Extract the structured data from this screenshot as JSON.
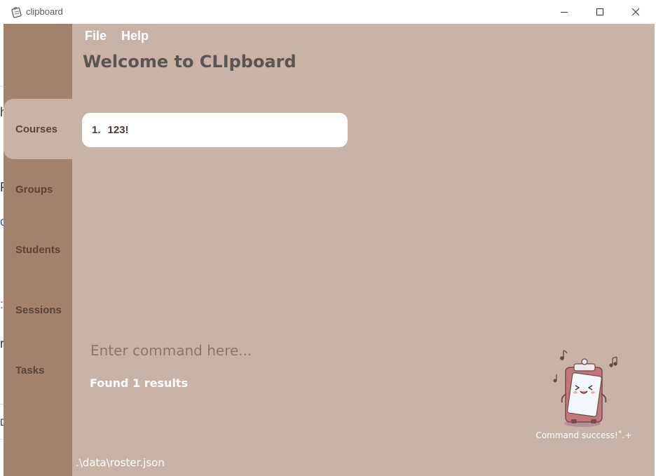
{
  "window": {
    "title": "clipboard",
    "icon": "clipboard-app-icon",
    "controls": [
      "minimize-icon",
      "maximize-icon",
      "close-icon"
    ]
  },
  "background_fragments": [
    "h",
    "P",
    "c",
    ":",
    "r",
    "D"
  ],
  "menu": {
    "file": "File",
    "help": "Help"
  },
  "welcome": "Welcome to CLIpboard",
  "sidebar": {
    "items": [
      {
        "label": "Courses",
        "active": true
      },
      {
        "label": "Groups",
        "active": false
      },
      {
        "label": "Students",
        "active": false
      },
      {
        "label": "Sessions",
        "active": false
      },
      {
        "label": "Tasks",
        "active": false
      }
    ]
  },
  "list": {
    "items": [
      {
        "index": "1.",
        "name": "123!"
      }
    ]
  },
  "command": {
    "placeholder": "Enter command here...",
    "value": ""
  },
  "result": "Found 1 results",
  "mascot": {
    "icon": "clipboard-mascot-icon",
    "caption": "Command success!˚.+"
  },
  "status": {
    "path": ".\\data\\roster.json"
  },
  "colors": {
    "sidebar": "#a3826d",
    "main": "#c9b3a6",
    "text_dark": "#595552",
    "card": "#ffffff"
  }
}
